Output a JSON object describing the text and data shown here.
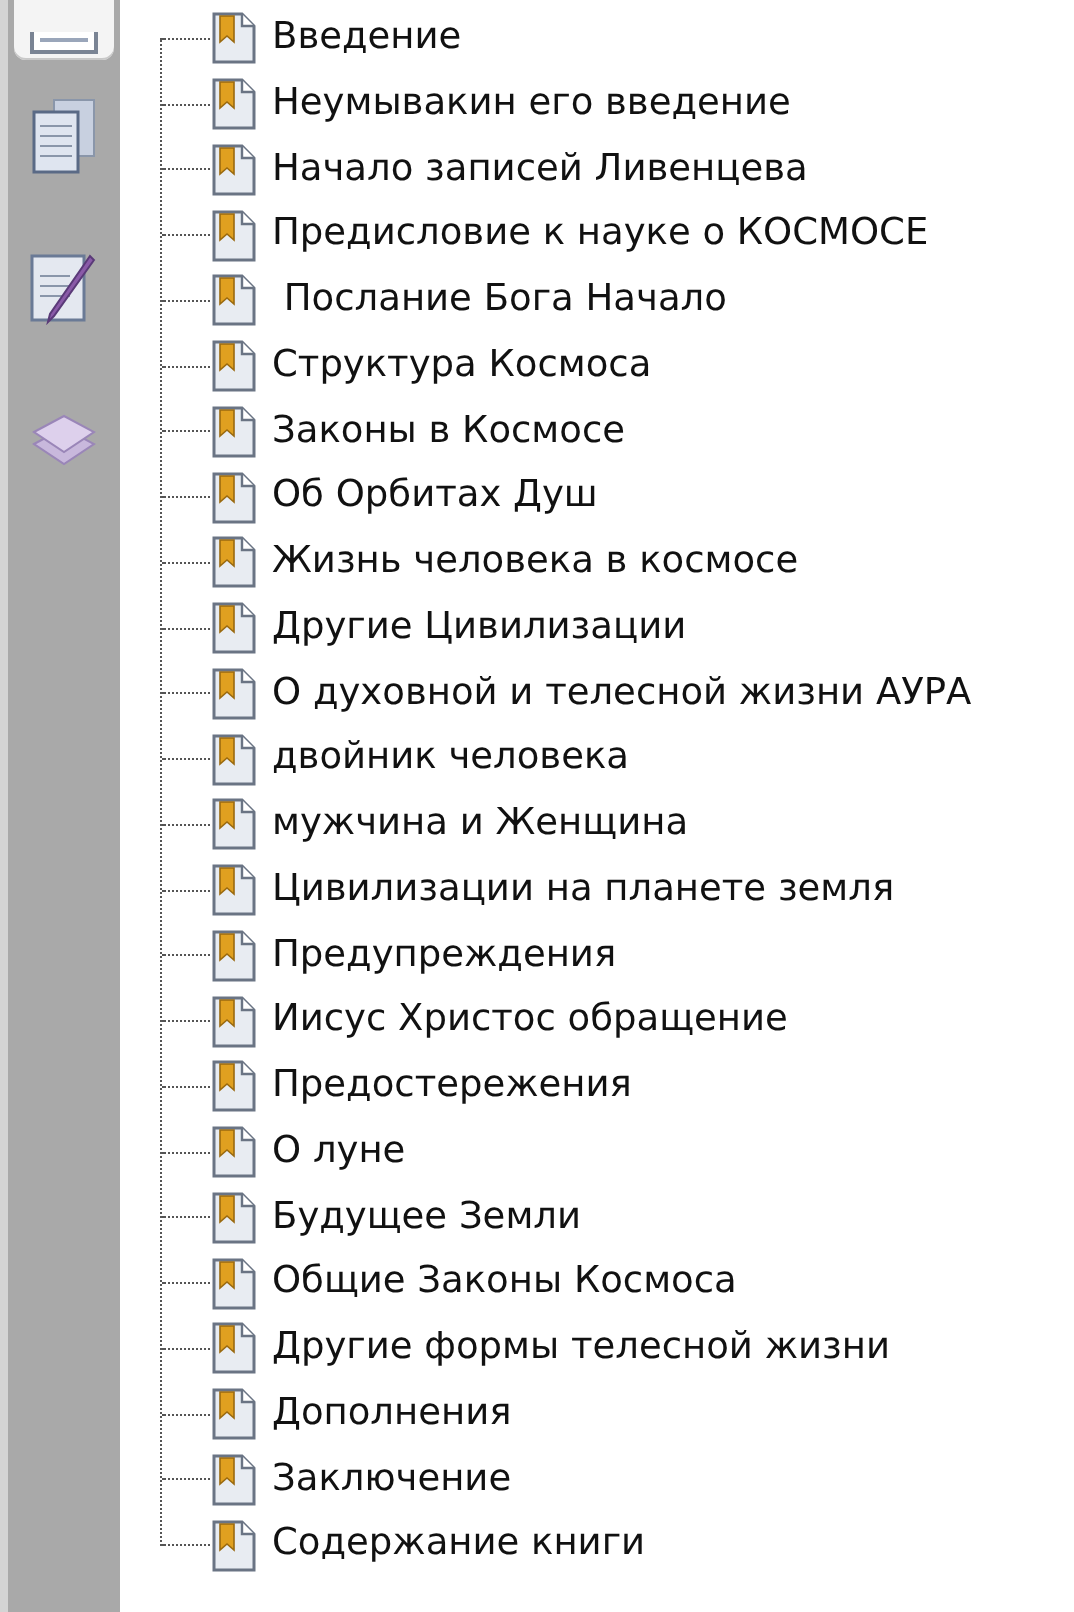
{
  "side_tabs": [
    {
      "kind": "bookmarks",
      "selected": true
    },
    {
      "kind": "pages",
      "selected": false
    },
    {
      "kind": "signatures",
      "selected": false
    },
    {
      "kind": "layers",
      "selected": false
    }
  ],
  "bookmarks": [
    {
      "label": "Введение"
    },
    {
      "label": "Неумывакин его введение"
    },
    {
      "label": "Начало записей Ливенцева"
    },
    {
      "label": "Предисловие к науке о КОСМОСЕ"
    },
    {
      "label": " Послание Бога Начало"
    },
    {
      "label": "Структура Космоса"
    },
    {
      "label": "Законы в Космосе"
    },
    {
      "label": "Об Орбитах Душ"
    },
    {
      "label": "Жизнь человека в космосе"
    },
    {
      "label": "Другие Цивилизации"
    },
    {
      "label": "О духовной и телесной жизни АУРА"
    },
    {
      "label": "двойник человека"
    },
    {
      "label": "мужчина и Женщина"
    },
    {
      "label": "Цивилизации на планете земля"
    },
    {
      "label": "Предупреждения"
    },
    {
      "label": "Иисус Христос обращение"
    },
    {
      "label": "Предостережения"
    },
    {
      "label": "О луне"
    },
    {
      "label": "Будущее Земли"
    },
    {
      "label": "Общие Законы Космоса"
    },
    {
      "label": "Другие формы телесной жизни"
    },
    {
      "label": "Дополнения"
    },
    {
      "label": "Заключение"
    },
    {
      "label": "Содержание книги"
    }
  ]
}
